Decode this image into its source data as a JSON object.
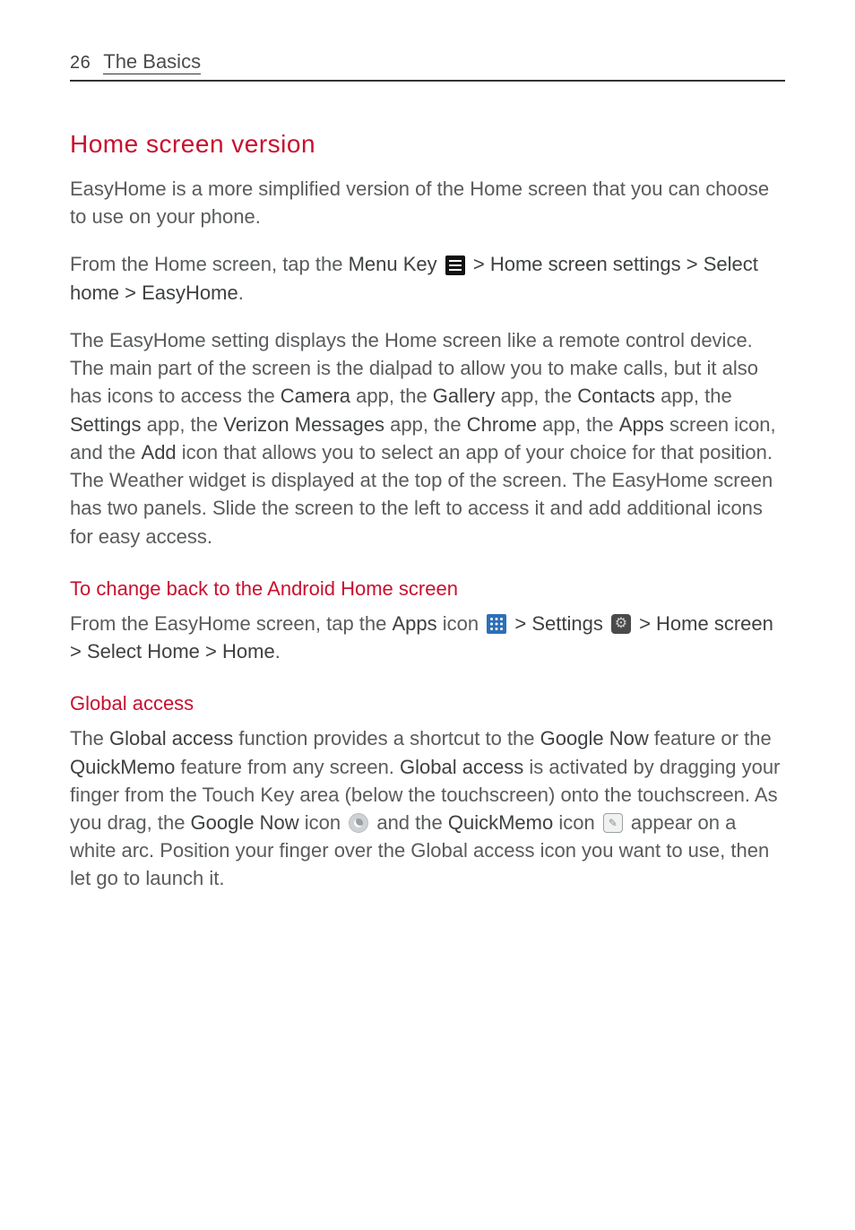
{
  "page": {
    "number": "26",
    "section": "The Basics"
  },
  "h2_home_version": "Home screen version",
  "para_easyhome_intro": "EasyHome is a more simplified version of the Home screen that you can choose to use on your phone.",
  "nav1": {
    "pre": "From the Home screen, tap the ",
    "menu_key": "Menu Key",
    "sep1": " > ",
    "hss": "Home screen settings",
    "sep2": " > ",
    "select_home": "Select home",
    "sep3": " > ",
    "easyhome": "EasyHome",
    "end": "."
  },
  "para_long": {
    "a": "The EasyHome setting displays the Home screen like a remote control device.  The main part of the screen is the dialpad to allow you to make calls, but it also has icons to access the ",
    "camera": "Camera",
    "b": " app, the ",
    "gallery": "Gallery",
    "c": " app, the ",
    "contacts": "Contacts",
    "d": " app, the ",
    "settings": "Settings",
    "e": " app, the ",
    "vzm": "Verizon Messages",
    "f": " app, the ",
    "chrome": "Chrome",
    "g": " app, the ",
    "apps": "Apps",
    "h": " screen icon, and the ",
    "add": "Add",
    "i": " icon that allows you to select an app of your choice for that position. The Weather widget is displayed at the top of the screen.  The EasyHome screen has two panels.  Slide the screen to the left to access it and add additional icons for easy access."
  },
  "h3_change_back": "To change back to the Android Home screen",
  "nav2": {
    "pre": "From the EasyHome screen, tap the ",
    "apps": "Apps",
    "t_icon": " icon ",
    "sep1": " > ",
    "settings": "Settings",
    "sep2": " > ",
    "home_screen": "Home screen",
    "sep3": " > ",
    "select_home": "Select Home",
    "sep4": " > ",
    "home": "Home",
    "end": "."
  },
  "h3_global": "Global access",
  "para_global": {
    "a": "The ",
    "ga": "Global access",
    "b": " function provides a shortcut to the ",
    "gn": "Google Now",
    "c": " feature or the ",
    "qm": "QuickMemo",
    "d": " feature from any screen. ",
    "ga2": "Global access",
    "e": " is activated by dragging your finger from the Touch Key area (below the touchscreen) onto the touchscreen. As you drag, the ",
    "gn2": "Google Now",
    "f": " icon ",
    "g": " and the ",
    "qm2": "QuickMemo",
    "h": " icon ",
    "i": " appear on a white arc. Position your finger over the Global access icon you want to use, then let go to launch it."
  }
}
